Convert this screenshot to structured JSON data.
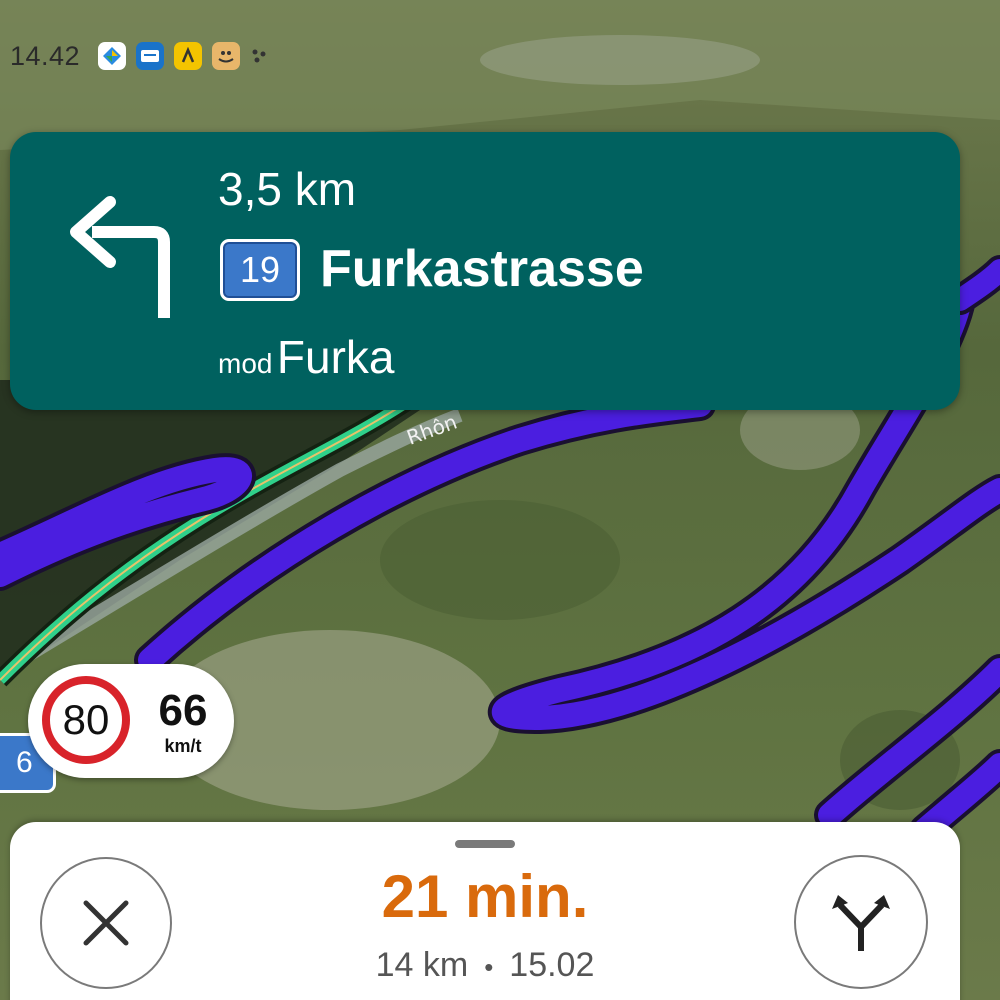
{
  "status_bar": {
    "time": "14.42",
    "icons": [
      "google-maps-icon",
      "messages-icon",
      "rb-app-icon",
      "amazon-box-icon",
      "more-dots-icon"
    ]
  },
  "instruction": {
    "distance": "3,5 km",
    "maneuver": "turn-left-arrow-icon",
    "route_number": "19",
    "street": "Furkastrasse",
    "toward_prefix": "mod",
    "toward": "Furka"
  },
  "map": {
    "type": "satellite",
    "river_label": "Rhôn",
    "route_color": "#4b1ee0",
    "side_road_color": "#2fd08a",
    "side_route_badge": "6"
  },
  "speed": {
    "limit": "80",
    "current": "66",
    "unit": "km/t"
  },
  "trip": {
    "duration": "21 min.",
    "distance": "14 km",
    "separator": "•",
    "arrival": "15.02"
  },
  "colors": {
    "card": "#00615f",
    "eta": "#d96a0c",
    "route_badge": "#3b78c9",
    "speed_limit_ring": "#d8232a"
  }
}
